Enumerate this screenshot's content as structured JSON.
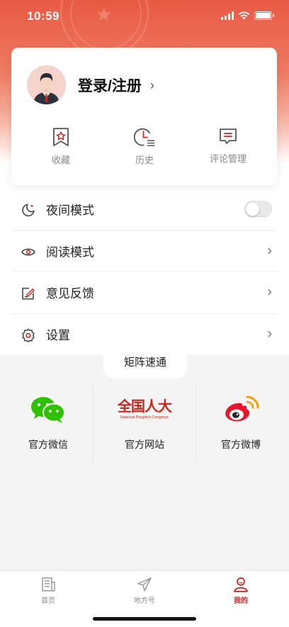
{
  "status_bar": {
    "time": "10:59"
  },
  "profile": {
    "login_label": "登录/注册"
  },
  "quick_actions": [
    {
      "label": "收藏",
      "icon": "bookmark-star-icon"
    },
    {
      "label": "历史",
      "icon": "clock-history-icon"
    },
    {
      "label": "评论管理",
      "icon": "comment-icon"
    }
  ],
  "menu": [
    {
      "label": "夜间模式",
      "icon": "moon-icon",
      "control": "toggle",
      "toggle_on": false
    },
    {
      "label": "阅读模式",
      "icon": "eye-icon",
      "control": "chevron"
    },
    {
      "label": "意见反馈",
      "icon": "feedback-icon",
      "control": "chevron"
    },
    {
      "label": "设置",
      "icon": "gear-icon",
      "control": "chevron"
    }
  ],
  "matrix": {
    "title": "矩阵速通",
    "items": [
      {
        "label": "官方微信",
        "icon": "wechat-icon"
      },
      {
        "label": "官方网站",
        "icon": "npc-logo-icon",
        "logo_text": "全国人大",
        "logo_subtext": "National People's Congress"
      },
      {
        "label": "官方微博",
        "icon": "weibo-icon"
      }
    ]
  },
  "tabbar": [
    {
      "label": "首页",
      "icon": "newspaper-icon",
      "active": false
    },
    {
      "label": "地方号",
      "icon": "paper-plane-icon",
      "active": false
    },
    {
      "label": "我的",
      "icon": "user-icon",
      "active": true
    }
  ],
  "colors": {
    "accent": "#c8261d",
    "header": "#e85a44",
    "wechat": "#2dc100",
    "weibo": "#e6162d"
  }
}
